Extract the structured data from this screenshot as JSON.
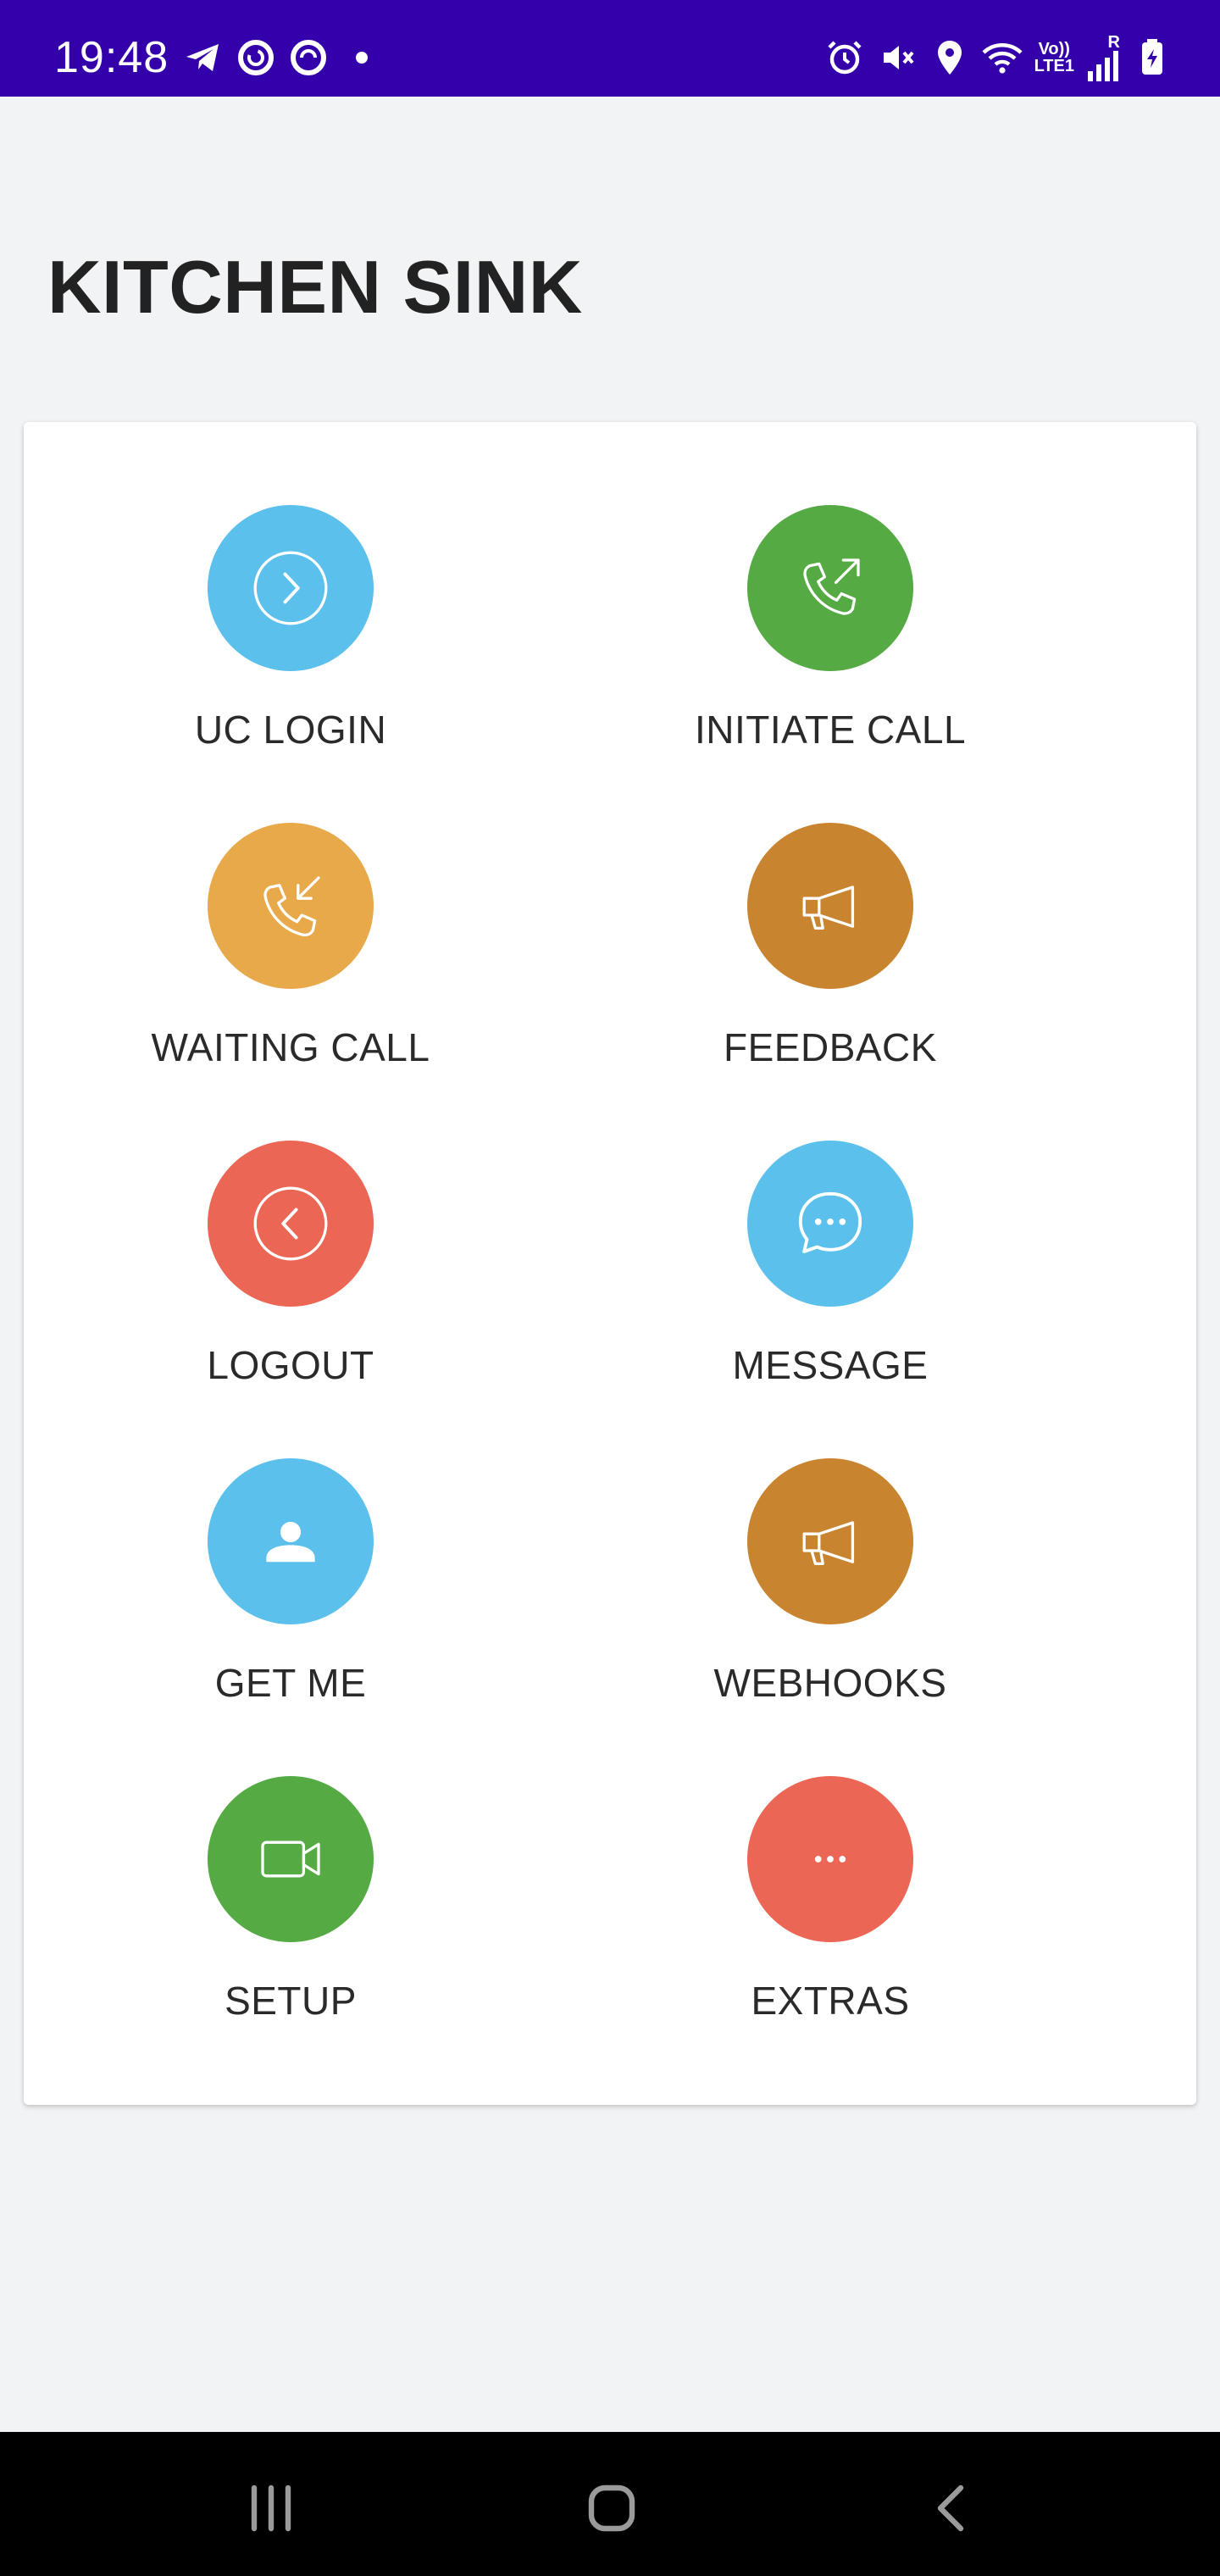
{
  "status_bar": {
    "time": "19:48",
    "left_icons": [
      "telegram-icon",
      "sync-icon",
      "sync-icon",
      "notification-dot"
    ],
    "right_icons": [
      "alarm-icon",
      "vibrate-off-icon",
      "location-icon",
      "wifi-icon",
      "volte-lte-icon",
      "signal-icon",
      "battery-charging-icon"
    ],
    "volte_top": "Vo))",
    "volte_bottom": "LTE1",
    "roaming": "R",
    "background_color": "#3300aa"
  },
  "page": {
    "title": "KITCHEN SINK"
  },
  "menu": {
    "items": [
      {
        "label": "UC LOGIN",
        "icon": "chevron-right-circle-icon",
        "color": "#5bc0ec"
      },
      {
        "label": "INITIATE CALL",
        "icon": "phone-outgoing-icon",
        "color": "#55aa44"
      },
      {
        "label": "WAITING CALL",
        "icon": "phone-incoming-icon",
        "color": "#e8a94a"
      },
      {
        "label": "FEEDBACK",
        "icon": "megaphone-icon",
        "color": "#c98430"
      },
      {
        "label": "LOGOUT",
        "icon": "chevron-left-circle-icon",
        "color": "#ec6655"
      },
      {
        "label": "MESSAGE",
        "icon": "chat-bubble-icon",
        "color": "#5bc0ec"
      },
      {
        "label": "GET ME",
        "icon": "person-icon",
        "color": "#5bc0ec"
      },
      {
        "label": "WEBHOOKS",
        "icon": "megaphone-icon",
        "color": "#c98430"
      },
      {
        "label": "SETUP",
        "icon": "video-camera-icon",
        "color": "#55aa44"
      },
      {
        "label": "EXTRAS",
        "icon": "more-dots-icon",
        "color": "#ec6655"
      }
    ]
  },
  "nav_bar": {
    "buttons": [
      "recent-apps-icon",
      "home-icon",
      "back-icon"
    ]
  }
}
